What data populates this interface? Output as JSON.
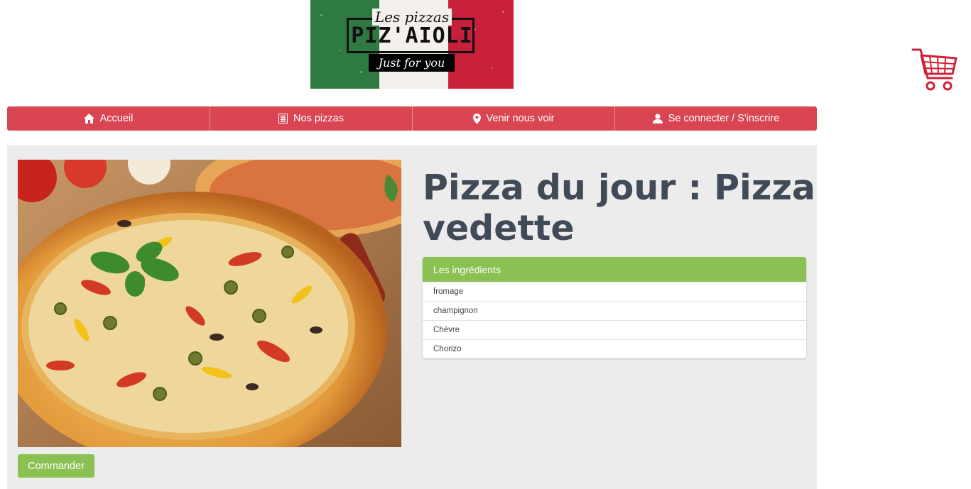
{
  "logo": {
    "top_line": "Les pizzas",
    "brand": "PIZ'AIOLI",
    "tagline": "Just for you"
  },
  "cart": {
    "icon": "shopping-cart-icon"
  },
  "nav": [
    {
      "label": "Accueil",
      "icon": "home-icon"
    },
    {
      "label": "Nos pizzas",
      "icon": "list-icon"
    },
    {
      "label": "Venir nous voir",
      "icon": "map-marker-icon"
    },
    {
      "label": "Se connecter / S'inscrire",
      "icon": "user-icon"
    }
  ],
  "main": {
    "title": "Pizza du jour : Pizza vedette",
    "order_button": "Commander",
    "ingredients_header": "Les ingrédients",
    "ingredients": [
      "fromage",
      "champignon",
      "Chèvre",
      "Chorizo"
    ]
  },
  "colors": {
    "nav": "#d94552",
    "accent_green": "#8bc152",
    "title": "#414a57",
    "panel": "#ececec"
  }
}
